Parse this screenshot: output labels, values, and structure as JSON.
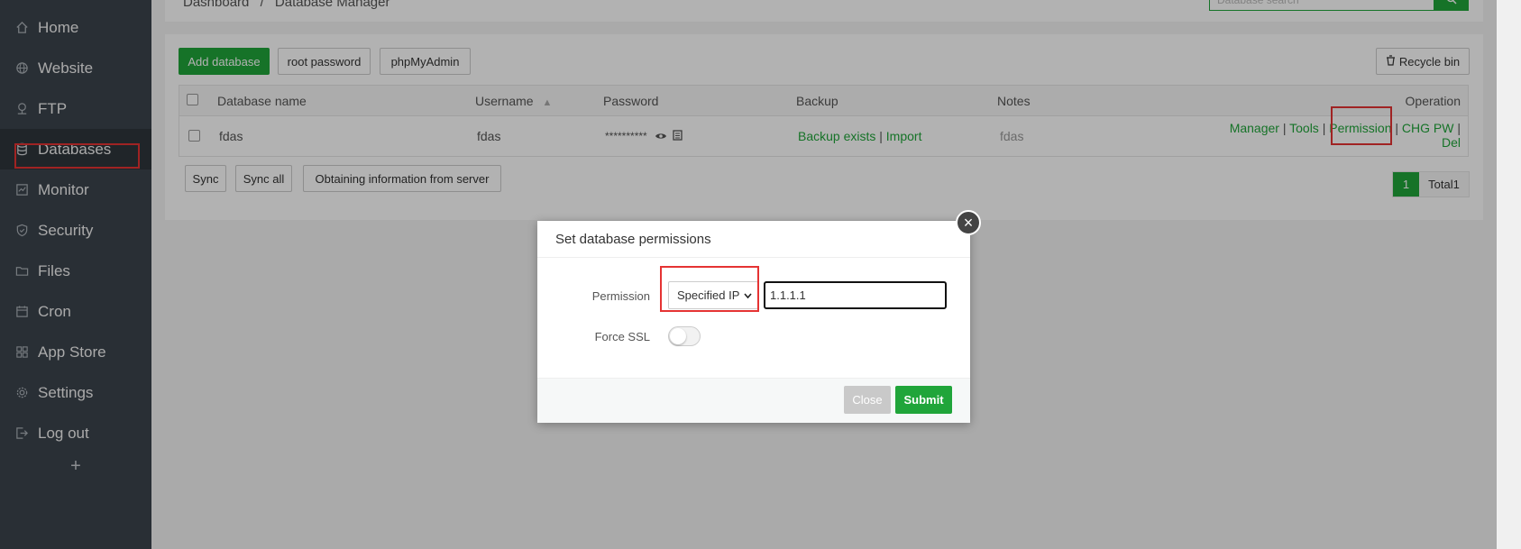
{
  "sidebar": {
    "items": [
      {
        "label": "Home",
        "icon": "home-icon"
      },
      {
        "label": "Website",
        "icon": "globe-icon"
      },
      {
        "label": "FTP",
        "icon": "ftp-icon"
      },
      {
        "label": "Databases",
        "icon": "database-icon"
      },
      {
        "label": "Monitor",
        "icon": "monitor-icon"
      },
      {
        "label": "Security",
        "icon": "shield-icon"
      },
      {
        "label": "Files",
        "icon": "folder-icon"
      },
      {
        "label": "Cron",
        "icon": "calendar-icon"
      },
      {
        "label": "App Store",
        "icon": "grid-icon"
      },
      {
        "label": "Settings",
        "icon": "gear-icon"
      },
      {
        "label": "Log out",
        "icon": "logout-icon"
      }
    ],
    "add_label": "+"
  },
  "breadcrumb": {
    "home": "Dashboard",
    "separator": "/",
    "current": "Database Manager"
  },
  "search": {
    "placeholder": "Database search"
  },
  "toolbar": {
    "add_database": "Add database",
    "root_password": "root password",
    "phpmyadmin": "phpMyAdmin",
    "recycle_bin": "Recycle bin"
  },
  "table": {
    "headers": {
      "name": "Database name",
      "username": "Username",
      "password": "Password",
      "backup": "Backup",
      "notes": "Notes",
      "operation": "Operation"
    },
    "rows": [
      {
        "name": "fdas",
        "username": "fdas",
        "password": "**********",
        "backup_exists": "Backup exists",
        "import": "Import",
        "notes": "fdas",
        "ops": {
          "manager": "Manager",
          "tools": "Tools",
          "permission": "Permission",
          "chg_pw": "CHG PW",
          "del": "Del",
          "sep": "|"
        }
      }
    ]
  },
  "footer_buttons": {
    "sync": "Sync",
    "sync_all": "Sync all",
    "obtain": "Obtaining information from server"
  },
  "pagination": {
    "current_page": "1",
    "total": "Total1"
  },
  "modal": {
    "title": "Set database permissions",
    "close_glyph": "×",
    "permission_label": "Permission",
    "permission_selected": "Specified IP",
    "ip_value": "1.1.1.1",
    "force_ssl_label": "Force SSL",
    "force_ssl_on": false,
    "close_button": "Close",
    "submit_button": "Submit"
  },
  "colors": {
    "accent": "#20a53a",
    "sidebar_bg": "#3c444d",
    "highlight": "#e53333"
  }
}
